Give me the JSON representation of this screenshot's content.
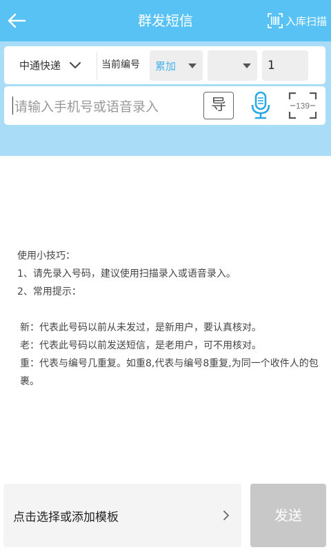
{
  "header": {
    "title": "群发短信",
    "scan_in_label": "入库扫描",
    "bg_color": "#59c2f5"
  },
  "row1": {
    "courier": "中通快递",
    "current_number_label": "当前编号",
    "mode": "累加",
    "mode_color": "#47b3ec",
    "second_select": "",
    "number_value": "1"
  },
  "row2": {
    "phone_placeholder": "请输入手机号或语音录入",
    "import_label": "导",
    "scan_number_hint": "139",
    "icons": [
      "import-icon",
      "microphone-icon",
      "scan-frame-icon"
    ]
  },
  "tips": {
    "heading": "使用小技巧：",
    "line1": "1、请先录入号码，建议使用扫描录入或语音录入。",
    "line2": "2、常用提示：",
    "new_line": "新：代表此号码以前从未发过，是新用户，要认真核对。",
    "old_line": "老：代表此号码以前发送短信，是老用户，可不用核对。",
    "repeat_line": "重：代表与编号几重复。如重8,代表与编号8重复,为同一个收件人的包裹。"
  },
  "bottom": {
    "template_label": "点击选择或添加模板",
    "send_label": "发送"
  }
}
